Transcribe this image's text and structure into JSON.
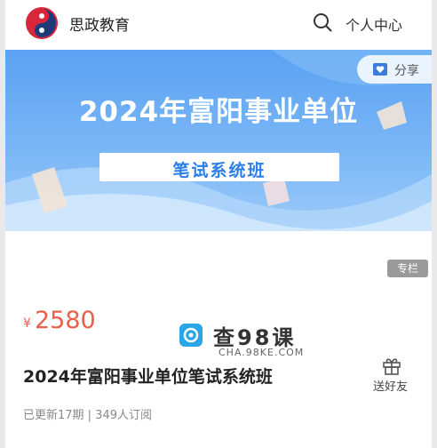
{
  "header": {
    "brand": "思政教育",
    "personal_center": "个人中心",
    "search_icon": "search-icon",
    "logo_colors": [
      "#d8263a",
      "#1f3a78"
    ]
  },
  "banner": {
    "title": "2024年富阳事业单位",
    "subtitle": "笔试系统班",
    "share_label": "分享",
    "share_icon": "heart-bookmark-icon",
    "accent": "#2b7ee8"
  },
  "content": {
    "tag": "专栏",
    "currency": "¥",
    "price": "2580",
    "title": "2024年富阳事业单位笔试系统班",
    "gift_label": "送好友",
    "gift_icon": "gift-icon",
    "meta": "已更新17期 | 349人订阅",
    "price_color": "#e8604a"
  },
  "watermark": {
    "text": "查98课",
    "domain": "CHA.98KE.COM"
  }
}
